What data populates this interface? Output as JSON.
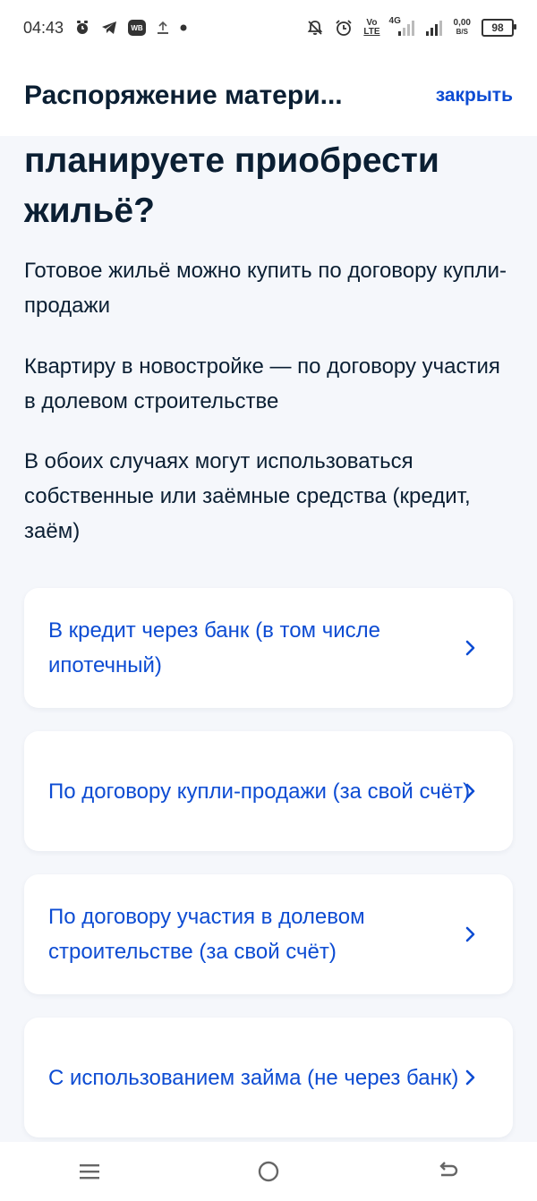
{
  "statusbar": {
    "time": "04:43",
    "left_icons": [
      "alarm-icon",
      "telegram-icon",
      "wb-icon",
      "upload-icon",
      "dot-icon"
    ],
    "wb_text": "WB",
    "volte_top": "Vo",
    "volte_bottom": "LTE",
    "network": "4G",
    "speed_value": "0,00",
    "speed_unit": "B/S",
    "battery": "98"
  },
  "header": {
    "title": "Распоряжение матери...",
    "close_label": "закрыть"
  },
  "question": {
    "title": "планируете приобрести жильё?"
  },
  "paragraphs": [
    "Готовое жильё можно купить по договору купли-продажи",
    "Квартиру в новостройке — по договору участия в долевом строительстве",
    "В обоих случаях могут использоваться собственные или заёмные средства (кредит, заём)"
  ],
  "options": [
    {
      "label": "В кредит через банк (в том числе ипотечный)"
    },
    {
      "label": "По договору купли-продажи (за свой счёт)"
    },
    {
      "label": "По договору участия в долевом строительстве (за свой счёт)"
    },
    {
      "label": "С использованием займа (не через банк)"
    }
  ],
  "colors": {
    "accent": "#0d4cd3",
    "text": "#0b1f33",
    "background": "#f5f7fb",
    "card": "#ffffff"
  },
  "navbar": {
    "icons": [
      "menu-icon",
      "home-icon",
      "back-icon"
    ]
  }
}
